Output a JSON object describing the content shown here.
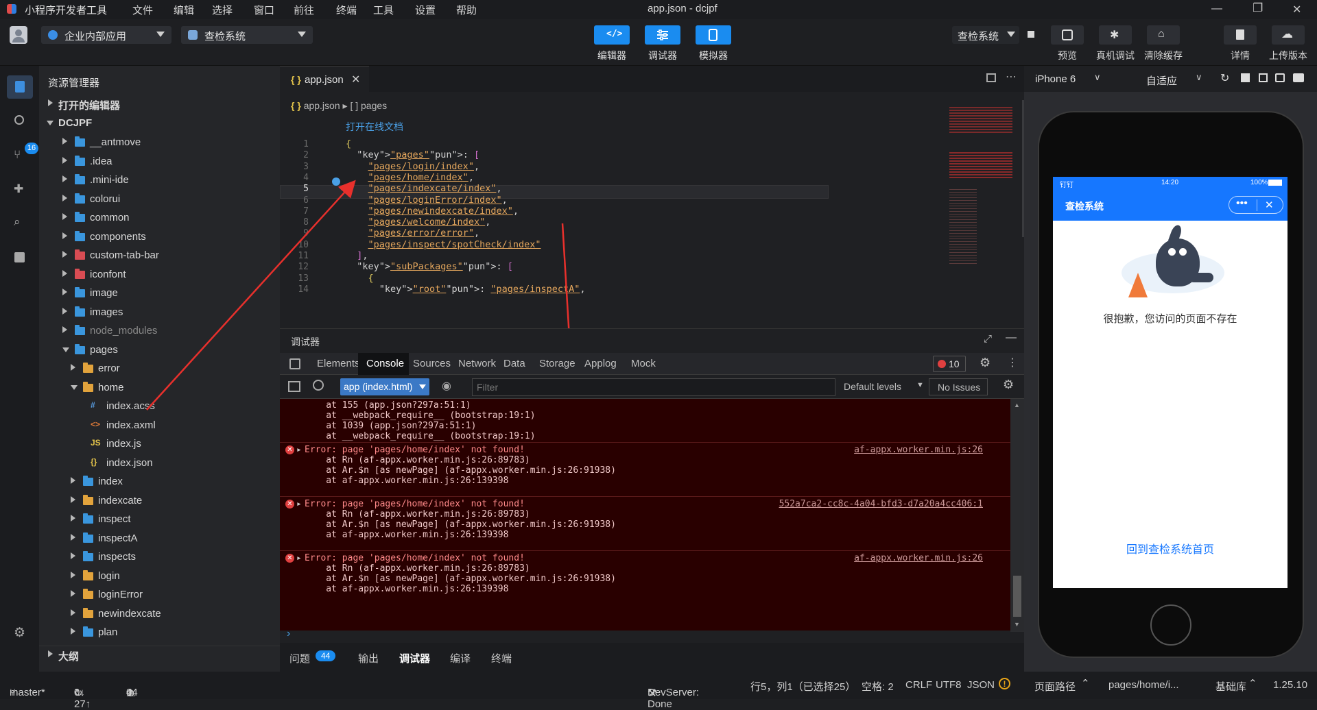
{
  "app": {
    "name": "小程序开发者工具",
    "window_title": "app.json - dcjpf"
  },
  "menu": [
    "文件",
    "编辑",
    "选择",
    "窗口",
    "前往",
    "终端",
    "工具",
    "设置",
    "帮助"
  ],
  "toolbar": {
    "app_type": "企业内部应用",
    "project": "查检系统",
    "modes": [
      "编辑器",
      "调试器",
      "模拟器"
    ],
    "compile_target": "查检系统",
    "actions": [
      "预览",
      "真机调试",
      "清除缓存"
    ],
    "right_actions": [
      "详情",
      "上传版本"
    ]
  },
  "activity": {
    "badge": "16"
  },
  "explorer": {
    "title": "资源管理器",
    "open_editors": "打开的编辑器",
    "root": "DCJPF",
    "items": [
      {
        "name": "__antmove",
        "depth": 1,
        "type": "folder",
        "expanded": false,
        "color": "blue"
      },
      {
        "name": ".idea",
        "depth": 1,
        "type": "folder",
        "expanded": false,
        "color": "blue"
      },
      {
        "name": ".mini-ide",
        "depth": 1,
        "type": "folder",
        "expanded": false,
        "color": "blue"
      },
      {
        "name": "colorui",
        "depth": 1,
        "type": "folder",
        "expanded": false,
        "color": "blue"
      },
      {
        "name": "common",
        "depth": 1,
        "type": "folder",
        "expanded": false,
        "color": "blue"
      },
      {
        "name": "components",
        "depth": 1,
        "type": "folder",
        "expanded": false,
        "color": "blue"
      },
      {
        "name": "custom-tab-bar",
        "depth": 1,
        "type": "folder",
        "expanded": false,
        "color": "red"
      },
      {
        "name": "iconfont",
        "depth": 1,
        "type": "folder",
        "expanded": false,
        "color": "red"
      },
      {
        "name": "image",
        "depth": 1,
        "type": "folder",
        "expanded": false,
        "color": "blue"
      },
      {
        "name": "images",
        "depth": 1,
        "type": "folder",
        "expanded": false,
        "color": "blue"
      },
      {
        "name": "node_modules",
        "depth": 1,
        "type": "folder",
        "expanded": false,
        "color": "blue",
        "dim": true
      },
      {
        "name": "pages",
        "depth": 1,
        "type": "folder",
        "expanded": true,
        "color": "blue"
      },
      {
        "name": "error",
        "depth": 2,
        "type": "folder",
        "expanded": false,
        "color": "orange"
      },
      {
        "name": "home",
        "depth": 2,
        "type": "folder",
        "expanded": true,
        "color": "orange"
      },
      {
        "name": "index.acss",
        "depth": 3,
        "type": "file",
        "icon": "#",
        "icolor": "#5aa0e6"
      },
      {
        "name": "index.axml",
        "depth": 3,
        "type": "file",
        "icon": "<>",
        "icolor": "#e07b39"
      },
      {
        "name": "index.js",
        "depth": 3,
        "type": "file",
        "icon": "JS",
        "icolor": "#e2c24a"
      },
      {
        "name": "index.json",
        "depth": 3,
        "type": "file",
        "icon": "{}",
        "icolor": "#e2c24a"
      },
      {
        "name": "index",
        "depth": 2,
        "type": "folder",
        "expanded": false,
        "color": "blue"
      },
      {
        "name": "indexcate",
        "depth": 2,
        "type": "folder",
        "expanded": false,
        "color": "orange"
      },
      {
        "name": "inspect",
        "depth": 2,
        "type": "folder",
        "expanded": false,
        "color": "blue"
      },
      {
        "name": "inspectA",
        "depth": 2,
        "type": "folder",
        "expanded": false,
        "color": "blue"
      },
      {
        "name": "inspects",
        "depth": 2,
        "type": "folder",
        "expanded": false,
        "color": "blue"
      },
      {
        "name": "login",
        "depth": 2,
        "type": "folder",
        "expanded": false,
        "color": "orange"
      },
      {
        "name": "loginError",
        "depth": 2,
        "type": "folder",
        "expanded": false,
        "color": "orange"
      },
      {
        "name": "newindexcate",
        "depth": 2,
        "type": "folder",
        "expanded": false,
        "color": "orange"
      },
      {
        "name": "plan",
        "depth": 2,
        "type": "folder",
        "expanded": false,
        "color": "blue"
      }
    ],
    "outline": "大纲"
  },
  "editor": {
    "tab": "app.json",
    "tab_icon": "{ }",
    "breadcrumb_file": "app.json",
    "breadcrumb_node": "[ ] pages",
    "doc_link": "打开在线文档",
    "lines": [
      {
        "n": "1",
        "text": "{"
      },
      {
        "n": "2",
        "text": "  \"pages\": ["
      },
      {
        "n": "3",
        "text": "    \"pages/login/index\","
      },
      {
        "n": "4",
        "text": "    \"pages/home/index\","
      },
      {
        "n": "5",
        "text": "    \"pages/indexcate/index\","
      },
      {
        "n": "6",
        "text": "    \"pages/loginError/index\","
      },
      {
        "n": "7",
        "text": "    \"pages/newindexcate/index\","
      },
      {
        "n": "8",
        "text": "    \"pages/welcome/index\","
      },
      {
        "n": "9",
        "text": "    \"pages/error/error\","
      },
      {
        "n": "10",
        "text": "    \"pages/inspect/spotCheck/index\""
      },
      {
        "n": "11",
        "text": "  ],"
      },
      {
        "n": "12",
        "text": "  \"subPackages\": ["
      },
      {
        "n": "13",
        "text": "    {"
      },
      {
        "n": "14",
        "text": "      \"root\": \"pages/inspectA\","
      }
    ]
  },
  "debugger": {
    "title": "调试器",
    "tabs": [
      "Elements",
      "Console",
      "Sources",
      "Network",
      "Data",
      "Storage",
      "Applog",
      "Mock"
    ],
    "active_tab": "Console",
    "error_count": "10",
    "context": "app (index.html)",
    "filter_placeholder": "Filter",
    "levels": "Default levels",
    "issues": "No Issues",
    "stack_head": [
      "    at 155 (app.json?297a:51:1)",
      "    at __webpack_require__ (bootstrap:19:1)",
      "    at 1039 (app.json?297a:51:1)",
      "    at __webpack_require__ (bootstrap:19:1)"
    ],
    "errors": [
      {
        "msg": "Error: page 'pages/home/index' not found!",
        "src": "af-appx.worker.min.js:26",
        "stack": [
          "    at Rn (af-appx.worker.min.js:26:89783)",
          "    at Ar.$n [as newPage] (af-appx.worker.min.js:26:91938)",
          "    at af-appx.worker.min.js:26:139398"
        ]
      },
      {
        "msg": "Error: page 'pages/home/index' not found!",
        "src": "552a7ca2-cc8c-4a04-bfd3-d7a20a4cc406:1",
        "stack": [
          "    at Rn (af-appx.worker.min.js:26:89783)",
          "    at Ar.$n [as newPage] (af-appx.worker.min.js:26:91938)",
          "    at af-appx.worker.min.js:26:139398"
        ]
      },
      {
        "msg": "Error: page 'pages/home/index' not found!",
        "src": "af-appx.worker.min.js:26",
        "stack": [
          "    at Rn (af-appx.worker.min.js:26:89783)",
          "    at Ar.$n [as newPage] (af-appx.worker.min.js:26:91938)",
          "    at af-appx.worker.min.js:26:139398"
        ]
      }
    ],
    "prompt": "›",
    "bottom_tabs": [
      "问题",
      "输出",
      "调试器",
      "编译",
      "终端"
    ],
    "problems_count": "44"
  },
  "simulator": {
    "device": "iPhone 6",
    "zoom": "自适应",
    "status_carrier": "钉钉",
    "status_time": "14:20",
    "status_battery": "100%",
    "nav_title": "查检系统",
    "message": "很抱歉，您访问的页面不存在",
    "link": "回到查检系统首页",
    "nav_color": "#1677ff"
  },
  "statusbar": {
    "branch": "master*",
    "sync": "0↓ 27↑",
    "errors": "44",
    "warnings": "0",
    "devserver": "DevServer: Done",
    "position": "行5，列1（已选择25）",
    "spaces": "空格: 2",
    "eol": "CRLF",
    "encoding": "UTF8",
    "lang": "JSON",
    "page_path_label": "页面路径",
    "page_path": "pages/home/i...",
    "base_lib_label": "基础库",
    "base_lib": "1.25.10"
  }
}
